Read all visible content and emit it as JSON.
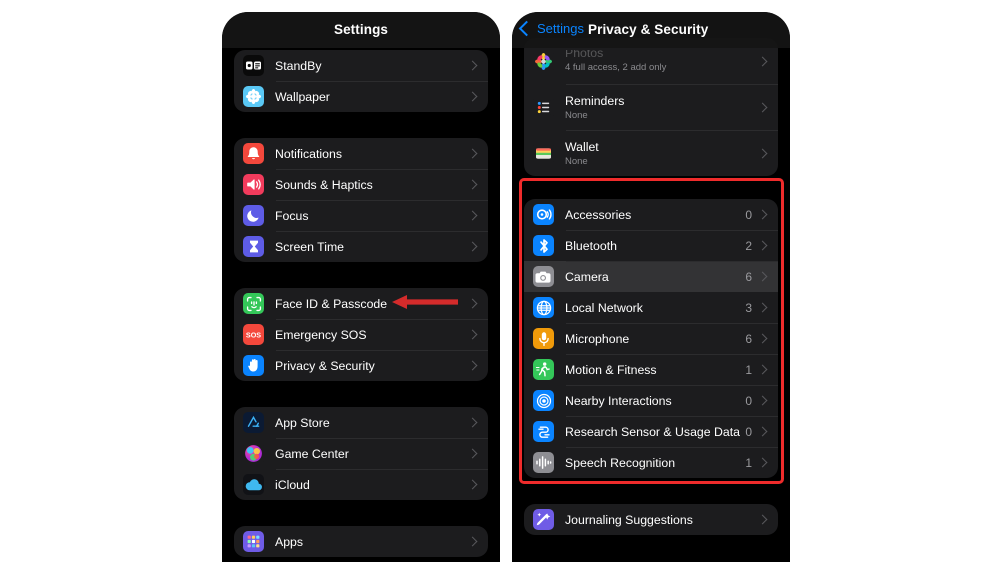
{
  "annotations": {
    "highlight_color": "#ef2b2b",
    "arrow_color": "#d42b2b",
    "arrow_target": "Face ID & Passcode",
    "highlight_target": "privacy sensor permissions group"
  },
  "left_panel": {
    "nav": {
      "title": "Settings"
    },
    "groups": [
      {
        "name": "display-group",
        "rows": [
          {
            "label": "StandBy",
            "icon": "standby-icon",
            "icon_bg": "#0a0a0a"
          },
          {
            "label": "Wallpaper",
            "icon": "wallpaper-icon",
            "icon_bg": "#5ac8f5"
          }
        ]
      },
      {
        "name": "alerts-group",
        "rows": [
          {
            "label": "Notifications",
            "icon": "bell-icon",
            "icon_bg": "#f4483c"
          },
          {
            "label": "Sounds & Haptics",
            "icon": "speaker-icon",
            "icon_bg": "#f23b5c"
          },
          {
            "label": "Focus",
            "icon": "moon-icon",
            "icon_bg": "#5e5ce6"
          },
          {
            "label": "Screen Time",
            "icon": "hourglass-icon",
            "icon_bg": "#5e5ce6"
          }
        ]
      },
      {
        "name": "security-group",
        "rows": [
          {
            "label": "Face ID & Passcode",
            "icon": "face-id-icon",
            "icon_bg": "#34c759"
          },
          {
            "label": "Emergency SOS",
            "icon": "sos-icon",
            "icon_bg": "#f4483c"
          },
          {
            "label": "Privacy & Security",
            "icon": "hand-icon",
            "icon_bg": "#0a84ff"
          }
        ]
      },
      {
        "name": "services-group",
        "rows": [
          {
            "label": "App Store",
            "icon": "app-store-icon",
            "icon_bg": "#0b1a33"
          },
          {
            "label": "Game Center",
            "icon": "game-center-icon",
            "icon_bg": "#1c1c1e"
          },
          {
            "label": "iCloud",
            "icon": "icloud-icon",
            "icon_bg": "#111216"
          }
        ]
      },
      {
        "name": "apps-group",
        "rows": [
          {
            "label": "Apps",
            "icon": "apps-icon",
            "icon_bg": "#6f5ce6"
          }
        ]
      }
    ]
  },
  "right_panel": {
    "nav": {
      "back_label": "Settings",
      "back_icon": "chevron-left-icon",
      "title": "Privacy & Security"
    },
    "groups": [
      {
        "name": "app-data-group",
        "rows": [
          {
            "label": "Photos",
            "sub": "4 full access, 2 add only",
            "icon": "photos-icon",
            "icon_bg": "#1c1c1e",
            "clipped": true
          },
          {
            "label": "Reminders",
            "sub": "None",
            "icon": "reminders-icon",
            "icon_bg": "#1c1c1e"
          },
          {
            "label": "Wallet",
            "sub": "None",
            "icon": "wallet-icon",
            "icon_bg": "#1c1c1e"
          }
        ]
      },
      {
        "name": "sensor-permissions-group",
        "highlighted": true,
        "rows": [
          {
            "label": "Accessories",
            "count": "0",
            "icon": "accessories-icon",
            "icon_bg": "#0a84ff"
          },
          {
            "label": "Bluetooth",
            "count": "2",
            "icon": "bluetooth-icon",
            "icon_bg": "#0a84ff"
          },
          {
            "label": "Camera",
            "count": "6",
            "icon": "camera-icon",
            "icon_bg": "#8e8e93",
            "selected": true
          },
          {
            "label": "Local Network",
            "count": "3",
            "icon": "local-network-icon",
            "icon_bg": "#0a84ff"
          },
          {
            "label": "Microphone",
            "count": "6",
            "icon": "microphone-icon",
            "icon_bg": "#f09a0a"
          },
          {
            "label": "Motion & Fitness",
            "count": "1",
            "icon": "motion-fitness-icon",
            "icon_bg": "#34c759"
          },
          {
            "label": "Nearby Interactions",
            "count": "0",
            "icon": "nearby-interactions-icon",
            "icon_bg": "#0a84ff"
          },
          {
            "label": "Research Sensor & Usage Data",
            "count": "0",
            "icon": "research-sensor-icon",
            "icon_bg": "#0a84ff"
          },
          {
            "label": "Speech Recognition",
            "count": "1",
            "icon": "speech-recognition-icon",
            "icon_bg": "#8e8e93"
          }
        ]
      },
      {
        "name": "journaling-group",
        "rows": [
          {
            "label": "Journaling Suggestions",
            "icon": "journaling-icon",
            "icon_bg": "#6f5ce6"
          }
        ]
      }
    ]
  }
}
